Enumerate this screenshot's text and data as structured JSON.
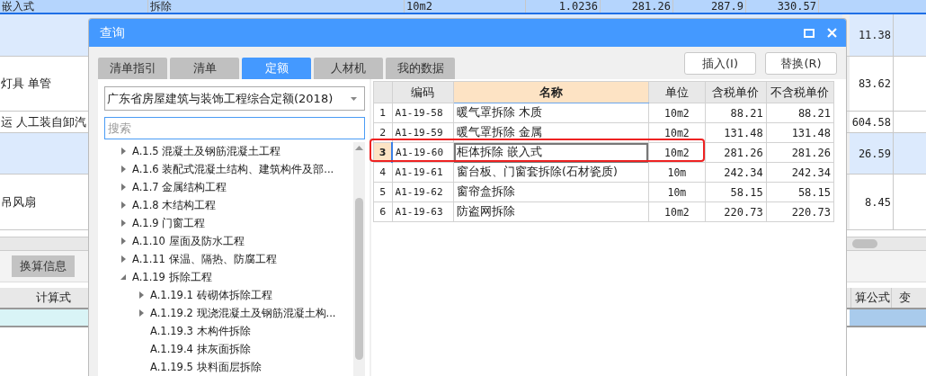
{
  "background": {
    "top_row": {
      "selected": true,
      "cells": [
        "嵌入式",
        "拆除",
        "10m2",
        "1.0236",
        "281.26",
        "287.9",
        "330.57"
      ]
    },
    "rows": [
      {
        "shade": true,
        "value": "11.38"
      },
      {
        "shade": false,
        "name": "灯具 单管",
        "value": "83.62"
      },
      {
        "shade": false,
        "name": "运 人工装自卸汽",
        "value": "604.58"
      },
      {
        "shade": true,
        "value": "26.59"
      },
      {
        "shade": false,
        "name": "吊风扇",
        "value": "8.45"
      }
    ],
    "lower_tabs": [
      {
        "label": "换算信息"
      }
    ],
    "lower_left_header": "计算式",
    "lower_right_headers": [
      "算公式",
      "变"
    ]
  },
  "dialog": {
    "title": "查询",
    "tabs": [
      {
        "label": "清单指引",
        "selected": false
      },
      {
        "label": "清单",
        "selected": false
      },
      {
        "label": "定额",
        "selected": true
      },
      {
        "label": "人材机",
        "selected": false
      },
      {
        "label": "我的数据",
        "selected": false
      }
    ],
    "buttons": [
      "插入(I)",
      "替换(R)"
    ],
    "library": {
      "value": "广东省房屋建筑与装饰工程综合定额(2018)"
    },
    "search": {
      "placeholder": "搜索"
    },
    "tree": [
      {
        "label": "A.1.5 混凝土及钢筋混凝土工程",
        "expanded": false
      },
      {
        "label": "A.1.6 装配式混凝土结构、建筑构件及部...",
        "expanded": false
      },
      {
        "label": "A.1.7 金属结构工程",
        "expanded": false
      },
      {
        "label": "A.1.8 木结构工程",
        "expanded": false
      },
      {
        "label": "A.1.9 门窗工程",
        "expanded": false
      },
      {
        "label": "A.1.10 屋面及防水工程",
        "expanded": false
      },
      {
        "label": "A.1.11 保温、隔热、防腐工程",
        "expanded": false
      },
      {
        "label": "A.1.19 拆除工程",
        "expanded": true,
        "children": [
          {
            "label": "A.1.19.1 砖砌体拆除工程",
            "expanded": false
          },
          {
            "label": "A.1.19.2 现浇混凝土及钢筋混凝土构...",
            "expanded": false
          },
          {
            "label": "A.1.19.3 木构件拆除"
          },
          {
            "label": "A.1.19.4 抹灰面拆除"
          },
          {
            "label": "A.1.19.5 块料面层拆除"
          }
        ]
      }
    ],
    "table": {
      "columns": [
        "编码",
        "名称",
        "单位",
        "含税单价",
        "不含税单价"
      ],
      "rows": [
        {
          "no": "1",
          "code": "A1-19-58",
          "name": "暖气罩拆除 木质",
          "unit": "10m2",
          "price_tax": "88.21",
          "price_notax": "88.21",
          "selected": false,
          "annotated": false
        },
        {
          "no": "2",
          "code": "A1-19-59",
          "name": "暖气罩拆除 金属",
          "unit": "10m2",
          "price_tax": "131.48",
          "price_notax": "131.48",
          "selected": false,
          "annotated": false
        },
        {
          "no": "3",
          "code": "A1-19-60",
          "name": "柜体拆除 嵌入式",
          "unit": "10m2",
          "price_tax": "281.26",
          "price_notax": "281.26",
          "selected": true,
          "annotated": true
        },
        {
          "no": "4",
          "code": "A1-19-61",
          "name": "窗台板、门窗套拆除(石材瓷质)",
          "unit": "10m",
          "price_tax": "242.34",
          "price_notax": "242.34",
          "selected": false,
          "annotated": false
        },
        {
          "no": "5",
          "code": "A1-19-62",
          "name": "窗帘盒拆除",
          "unit": "10m",
          "price_tax": "58.15",
          "price_notax": "58.15",
          "selected": false,
          "annotated": false
        },
        {
          "no": "6",
          "code": "A1-19-63",
          "name": "防盗网拆除",
          "unit": "10m2",
          "price_tax": "220.73",
          "price_notax": "220.73",
          "selected": false,
          "annotated": false
        }
      ]
    }
  }
}
